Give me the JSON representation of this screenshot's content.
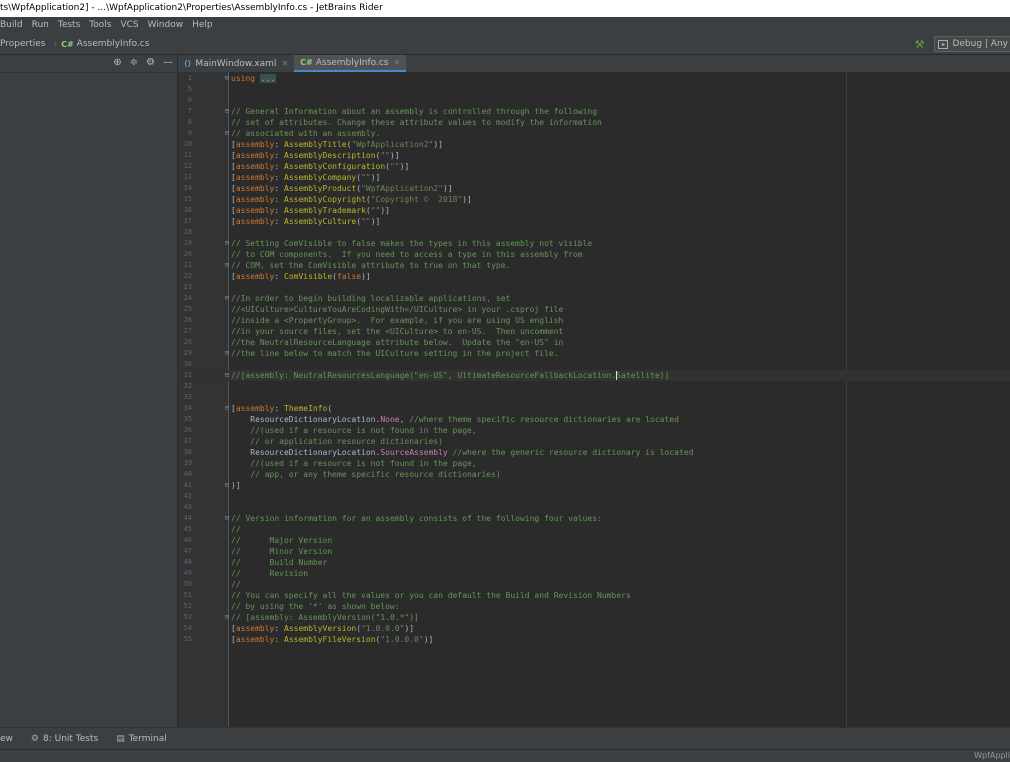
{
  "window_title": "ts\\WpfApplication2] - ...\\WpfApplication2\\Properties\\AssemblyInfo.cs - JetBrains Rider",
  "menu": [
    "Build",
    "Run",
    "Tests",
    "Tools",
    "VCS",
    "Window",
    "Help"
  ],
  "breadcrumbs": {
    "folder": "Properties",
    "file_badge": "C#",
    "file": "AssemblyInfo.cs"
  },
  "toolbar": {
    "run_config": "Debug | Any"
  },
  "tabs": [
    {
      "icon": "xaml",
      "label": "MainWindow.xaml",
      "active": false
    },
    {
      "icon": "C#",
      "label": "AssemblyInfo.cs",
      "active": true
    }
  ],
  "bottom_tools": [
    {
      "label": "ew"
    },
    {
      "label": "8: Unit Tests"
    },
    {
      "label": "Terminal"
    }
  ],
  "status_right": "WpfAppli",
  "code": {
    "current_line": 31,
    "lines": [
      {
        "n": 1,
        "fold": "⊟",
        "t": [
          [
            "kw",
            "using "
          ],
          [
            "fold",
            "..."
          ]
        ]
      },
      {
        "n": 5,
        "t": []
      },
      {
        "n": 6,
        "t": []
      },
      {
        "n": 7,
        "fold": "⊟",
        "t": [
          [
            "cm",
            "// General Information about an assembly is controlled through the following"
          ]
        ]
      },
      {
        "n": 8,
        "t": [
          [
            "cm",
            "// set of attributes. Change these attribute values to modify the information"
          ]
        ]
      },
      {
        "n": 9,
        "fold": "⊟",
        "t": [
          [
            "cm",
            "// associated with an assembly."
          ]
        ]
      },
      {
        "n": 10,
        "t": [
          [
            "plain",
            "["
          ],
          [
            "kw",
            "assembly"
          ],
          [
            "plain",
            ": "
          ],
          [
            "at",
            "AssemblyTitle"
          ],
          [
            "plain",
            "("
          ],
          [
            "str",
            "\"WpfApplication2\""
          ],
          [
            "plain",
            ")]"
          ]
        ]
      },
      {
        "n": 11,
        "t": [
          [
            "plain",
            "["
          ],
          [
            "kw",
            "assembly"
          ],
          [
            "plain",
            ": "
          ],
          [
            "at",
            "AssemblyDescription"
          ],
          [
            "plain",
            "("
          ],
          [
            "str",
            "\"\""
          ],
          [
            "plain",
            ")]"
          ]
        ]
      },
      {
        "n": 12,
        "t": [
          [
            "plain",
            "["
          ],
          [
            "kw",
            "assembly"
          ],
          [
            "plain",
            ": "
          ],
          [
            "at",
            "AssemblyConfiguration"
          ],
          [
            "plain",
            "("
          ],
          [
            "str",
            "\"\""
          ],
          [
            "plain",
            ")]"
          ]
        ]
      },
      {
        "n": 13,
        "t": [
          [
            "plain",
            "["
          ],
          [
            "kw",
            "assembly"
          ],
          [
            "plain",
            ": "
          ],
          [
            "at",
            "AssemblyCompany"
          ],
          [
            "plain",
            "("
          ],
          [
            "str",
            "\"\""
          ],
          [
            "plain",
            ")]"
          ]
        ]
      },
      {
        "n": 14,
        "t": [
          [
            "plain",
            "["
          ],
          [
            "kw",
            "assembly"
          ],
          [
            "plain",
            ": "
          ],
          [
            "at",
            "AssemblyProduct"
          ],
          [
            "plain",
            "("
          ],
          [
            "str",
            "\"WpfApplication2\""
          ],
          [
            "plain",
            ")]"
          ]
        ]
      },
      {
        "n": 15,
        "t": [
          [
            "plain",
            "["
          ],
          [
            "kw",
            "assembly"
          ],
          [
            "plain",
            ": "
          ],
          [
            "at",
            "AssemblyCopyright"
          ],
          [
            "plain",
            "("
          ],
          [
            "str",
            "\"Copyright ©  2018\""
          ],
          [
            "plain",
            ")]"
          ]
        ]
      },
      {
        "n": 16,
        "t": [
          [
            "plain",
            "["
          ],
          [
            "kw",
            "assembly"
          ],
          [
            "plain",
            ": "
          ],
          [
            "at",
            "AssemblyTrademark"
          ],
          [
            "plain",
            "("
          ],
          [
            "str",
            "\"\""
          ],
          [
            "plain",
            ")]"
          ]
        ]
      },
      {
        "n": 17,
        "t": [
          [
            "plain",
            "["
          ],
          [
            "kw",
            "assembly"
          ],
          [
            "plain",
            ": "
          ],
          [
            "at",
            "AssemblyCulture"
          ],
          [
            "plain",
            "("
          ],
          [
            "str",
            "\"\""
          ],
          [
            "plain",
            ")]"
          ]
        ]
      },
      {
        "n": 18,
        "t": []
      },
      {
        "n": 19,
        "fold": "⊟",
        "t": [
          [
            "cm",
            "// Setting ComVisible to false makes the types in this assembly not visible"
          ]
        ]
      },
      {
        "n": 20,
        "t": [
          [
            "cm",
            "// to COM components.  If you need to access a type in this assembly from"
          ]
        ]
      },
      {
        "n": 21,
        "fold": "⊟",
        "t": [
          [
            "cm",
            "// COM, set the ComVisible attribute to true on that type."
          ]
        ]
      },
      {
        "n": 22,
        "t": [
          [
            "plain",
            "["
          ],
          [
            "kw",
            "assembly"
          ],
          [
            "plain",
            ": "
          ],
          [
            "at",
            "ComVisible"
          ],
          [
            "plain",
            "("
          ],
          [
            "kw",
            "false"
          ],
          [
            "plain",
            ")]"
          ]
        ]
      },
      {
        "n": 23,
        "t": []
      },
      {
        "n": 24,
        "fold": "⊟",
        "t": [
          [
            "cm",
            "//In order to begin building localizable applications, set"
          ]
        ]
      },
      {
        "n": 25,
        "t": [
          [
            "cm",
            "//<UICulture>CultureYouAreCodingWith</UICulture> in your .csproj file"
          ]
        ]
      },
      {
        "n": 26,
        "t": [
          [
            "cm",
            "//inside a <PropertyGroup>.  For example, if you are using US english"
          ]
        ]
      },
      {
        "n": 27,
        "t": [
          [
            "cm",
            "//in your source files, set the <UICulture> to en-US.  Then uncomment"
          ]
        ]
      },
      {
        "n": 28,
        "t": [
          [
            "cm",
            "//the NeutralResourceLanguage attribute below.  Update the \"en-US\" in"
          ]
        ]
      },
      {
        "n": 29,
        "fold": "⊟",
        "t": [
          [
            "cm",
            "//the line below to match the UICulture setting in the project file."
          ]
        ]
      },
      {
        "n": 30,
        "t": []
      },
      {
        "n": 31,
        "fold": "⊟",
        "t": [
          [
            "cm",
            "//[assembly: NeutralResourcesLanguage(\"en-US\", UltimateResourceFallbackLocation."
          ],
          [
            "caret",
            ""
          ],
          [
            "cm",
            "Satellite)]"
          ]
        ]
      },
      {
        "n": 32,
        "t": []
      },
      {
        "n": 33,
        "t": []
      },
      {
        "n": 34,
        "fold": "⊟",
        "t": [
          [
            "plain",
            "["
          ],
          [
            "kw",
            "assembly"
          ],
          [
            "plain",
            ": "
          ],
          [
            "at",
            "ThemeInfo"
          ],
          [
            "plain",
            "("
          ]
        ]
      },
      {
        "n": 35,
        "t": [
          [
            "plain",
            "    ResourceDictionaryLocation."
          ],
          [
            "mag",
            "None"
          ],
          [
            "plain",
            ", "
          ],
          [
            "cm",
            "//where theme specific resource dictionaries are located"
          ]
        ]
      },
      {
        "n": 36,
        "t": [
          [
            "cm",
            "    //(used if a resource is not found in the page,"
          ]
        ]
      },
      {
        "n": 37,
        "t": [
          [
            "cm",
            "    // or application resource dictionaries)"
          ]
        ]
      },
      {
        "n": 38,
        "t": [
          [
            "plain",
            "    ResourceDictionaryLocation."
          ],
          [
            "mag",
            "SourceAssembly"
          ],
          [
            "plain",
            " "
          ],
          [
            "cm",
            "//where the generic resource dictionary is located"
          ]
        ]
      },
      {
        "n": 39,
        "t": [
          [
            "cm",
            "    //(used if a resource is not found in the page,"
          ]
        ]
      },
      {
        "n": 40,
        "t": [
          [
            "cm",
            "    // app, or any theme specific resource dictionaries)"
          ]
        ]
      },
      {
        "n": 41,
        "fold": "⊟",
        "t": [
          [
            "plain",
            ")]"
          ]
        ]
      },
      {
        "n": 42,
        "t": []
      },
      {
        "n": 43,
        "t": []
      },
      {
        "n": 44,
        "fold": "⊟",
        "t": [
          [
            "cm",
            "// Version information for an assembly consists of the following four values:"
          ]
        ]
      },
      {
        "n": 45,
        "t": [
          [
            "cm",
            "//"
          ]
        ]
      },
      {
        "n": 46,
        "t": [
          [
            "cm",
            "//      Major Version"
          ]
        ]
      },
      {
        "n": 47,
        "t": [
          [
            "cm",
            "//      Minor Version"
          ]
        ]
      },
      {
        "n": 48,
        "t": [
          [
            "cm",
            "//      Build Number"
          ]
        ]
      },
      {
        "n": 49,
        "t": [
          [
            "cm",
            "//      Revision"
          ]
        ]
      },
      {
        "n": 50,
        "t": [
          [
            "cm",
            "//"
          ]
        ]
      },
      {
        "n": 51,
        "t": [
          [
            "cm",
            "// You can specify all the values or you can default the Build and Revision Numbers"
          ]
        ]
      },
      {
        "n": 52,
        "t": [
          [
            "cm",
            "// by using the '*' as shown below:"
          ]
        ]
      },
      {
        "n": 53,
        "fold": "⊟",
        "t": [
          [
            "cm",
            "// [assembly: AssemblyVersion(\"1.0.*\")]"
          ]
        ]
      },
      {
        "n": 54,
        "t": [
          [
            "plain",
            "["
          ],
          [
            "kw",
            "assembly"
          ],
          [
            "plain",
            ": "
          ],
          [
            "at",
            "AssemblyVersion"
          ],
          [
            "plain",
            "("
          ],
          [
            "str",
            "\"1.0.0.0\""
          ],
          [
            "plain",
            ")]"
          ]
        ]
      },
      {
        "n": 55,
        "t": [
          [
            "plain",
            "["
          ],
          [
            "kw",
            "assembly"
          ],
          [
            "plain",
            ": "
          ],
          [
            "at",
            "AssemblyFileVersion"
          ],
          [
            "plain",
            "("
          ],
          [
            "str",
            "\"1.0.0.0\""
          ],
          [
            "plain",
            ")]"
          ]
        ]
      }
    ]
  }
}
